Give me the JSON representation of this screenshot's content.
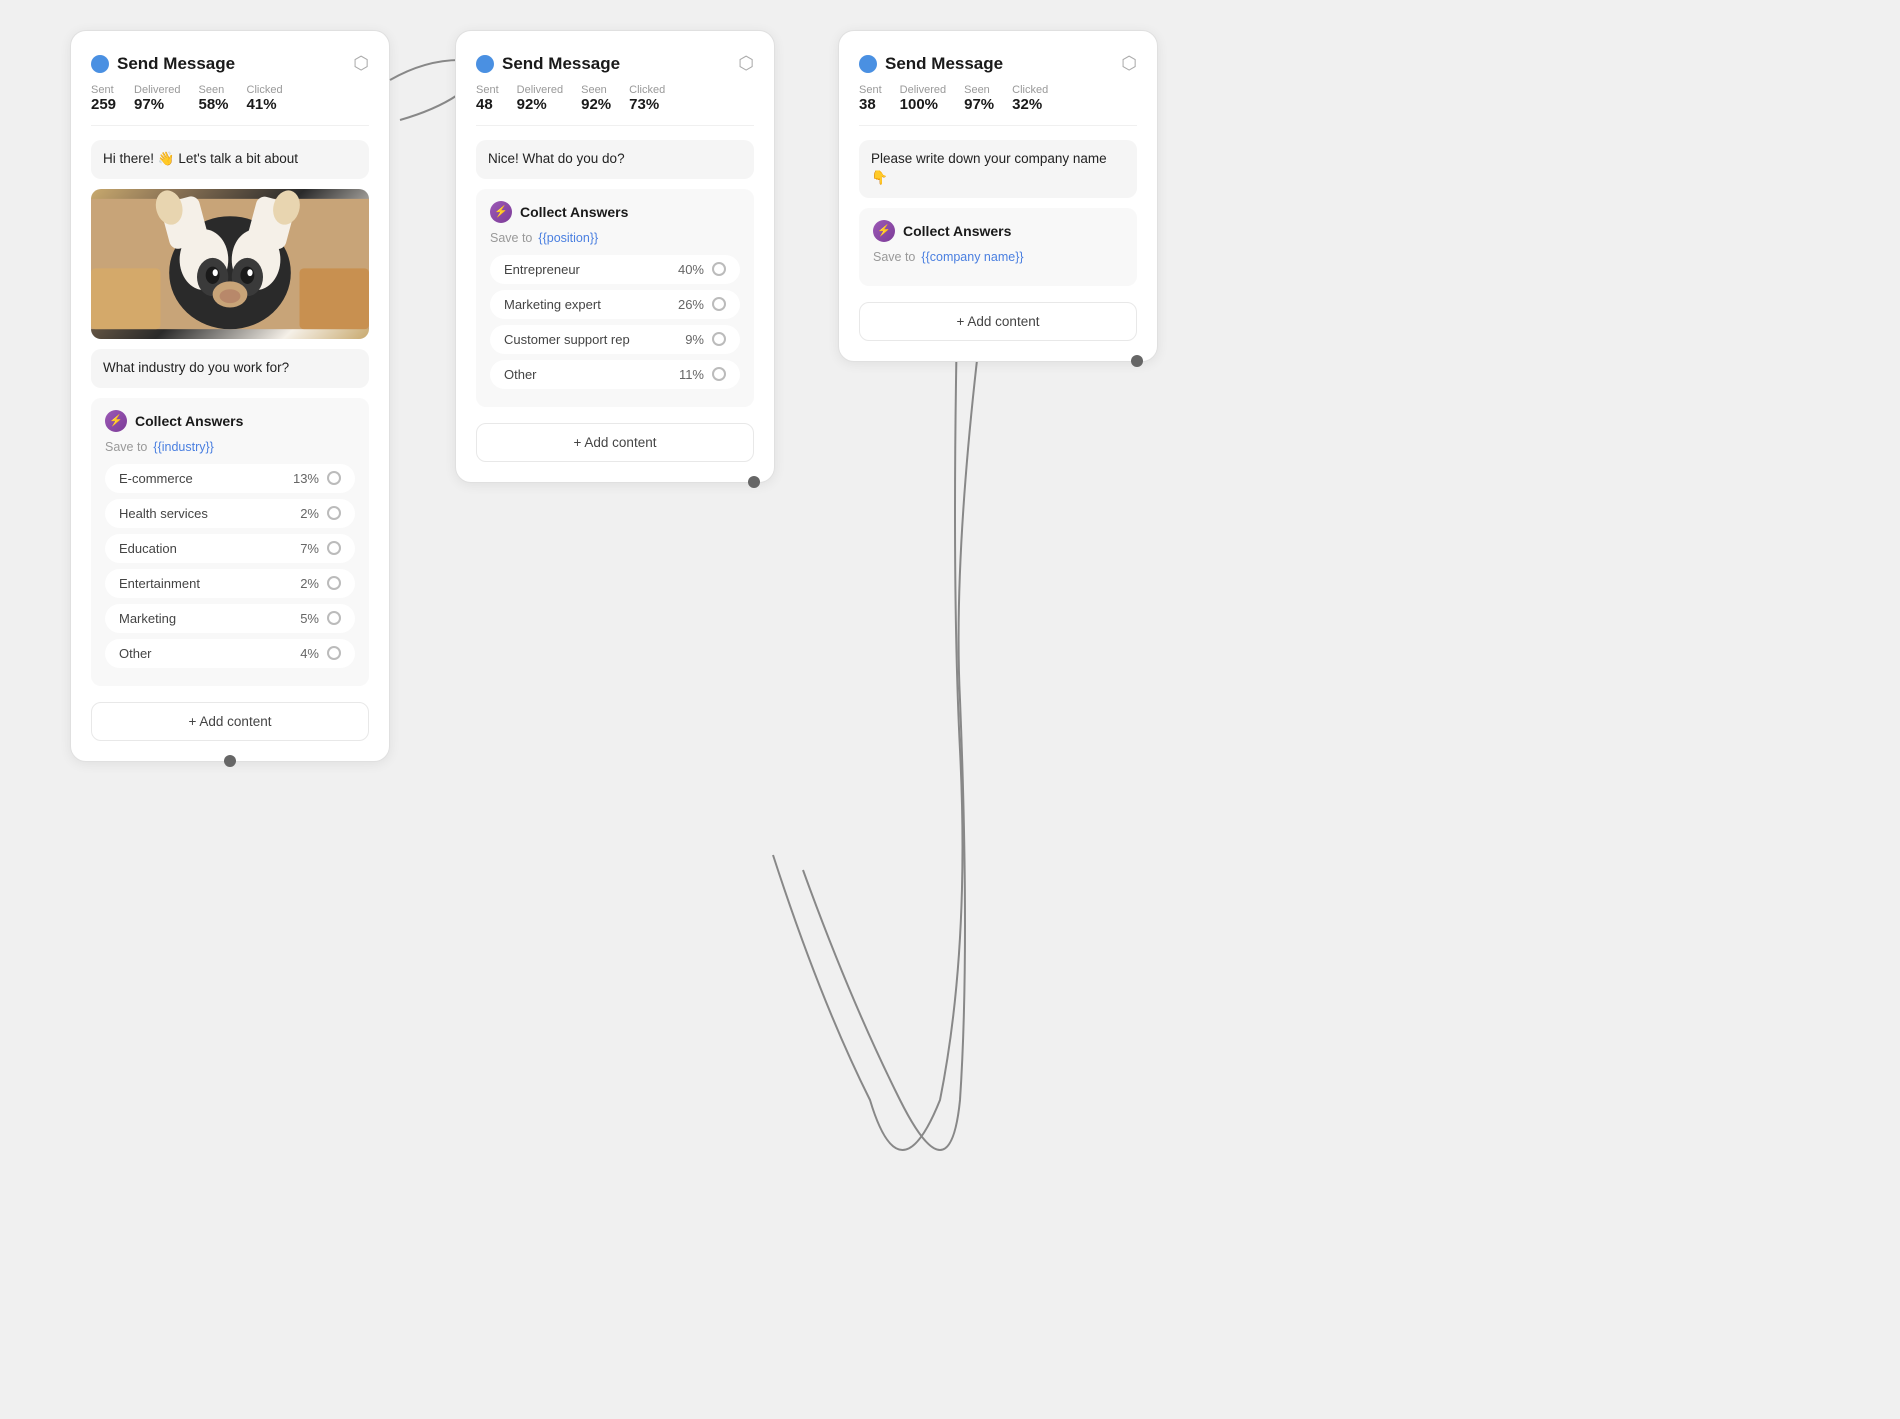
{
  "cards": [
    {
      "id": "card1",
      "title": "Send Message",
      "stats": [
        {
          "label": "Sent",
          "value": "259"
        },
        {
          "label": "Delivered",
          "value": "97%"
        },
        {
          "label": "Seen",
          "value": "58%"
        },
        {
          "label": "Clicked",
          "value": "41%"
        }
      ],
      "messages": [
        {
          "text": "Hi there! 👋 Let's talk a bit about"
        },
        {
          "type": "image"
        },
        {
          "text": "What industry do you work for?"
        }
      ],
      "collect": {
        "title": "Collect Answers",
        "save_to": "{{industry}}",
        "options": [
          {
            "label": "E-commerce",
            "pct": "13%"
          },
          {
            "label": "Health services",
            "pct": "2%"
          },
          {
            "label": "Education",
            "pct": "7%"
          },
          {
            "label": "Entertainment",
            "pct": "2%"
          },
          {
            "label": "Marketing",
            "pct": "5%"
          },
          {
            "label": "Other",
            "pct": "4%"
          }
        ]
      },
      "add_content": "+ Add content"
    },
    {
      "id": "card2",
      "title": "Send Message",
      "stats": [
        {
          "label": "Sent",
          "value": "48"
        },
        {
          "label": "Delivered",
          "value": "92%"
        },
        {
          "label": "Seen",
          "value": "92%"
        },
        {
          "label": "Clicked",
          "value": "73%"
        }
      ],
      "messages": [
        {
          "text": "Nice! What do you do?"
        }
      ],
      "collect": {
        "title": "Collect Answers",
        "save_to": "{{position}}",
        "options": [
          {
            "label": "Entrepreneur",
            "pct": "40%"
          },
          {
            "label": "Marketing expert",
            "pct": "26%"
          },
          {
            "label": "Customer support rep",
            "pct": "9%"
          },
          {
            "label": "Other",
            "pct": "11%"
          }
        ]
      },
      "add_content": "+ Add content"
    },
    {
      "id": "card3",
      "title": "Send Message",
      "stats": [
        {
          "label": "Sent",
          "value": "38"
        },
        {
          "label": "Delivered",
          "value": "100%"
        },
        {
          "label": "Seen",
          "value": "97%"
        },
        {
          "label": "Clicked",
          "value": "32%"
        }
      ],
      "messages": [
        {
          "text": "Please write down your company name 👇"
        }
      ],
      "collect": {
        "title": "Collect Answers",
        "save_to": "{{company name}}"
      },
      "add_content": "+ Add content"
    }
  ]
}
